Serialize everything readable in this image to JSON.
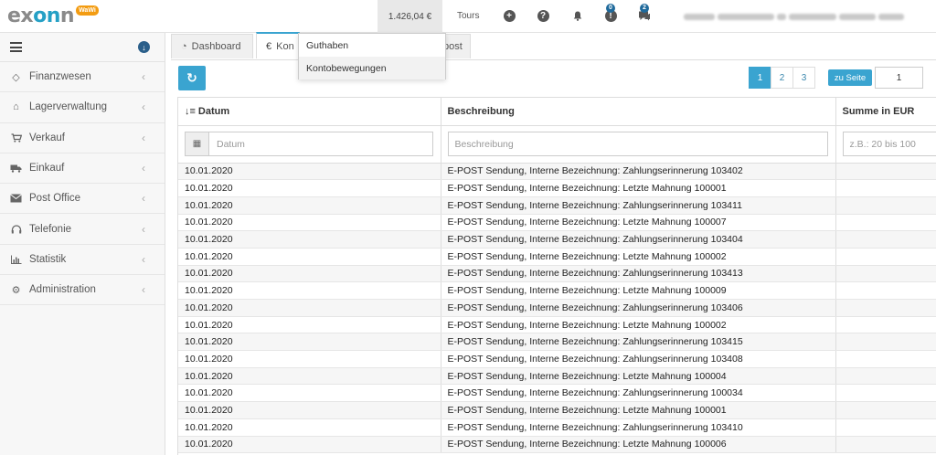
{
  "header": {
    "logo_main": "ex",
    "logo_o": "on",
    "logo_end": "n",
    "logo_badge": "WaWi",
    "balance": "1.426,04 €",
    "tours": "Tours",
    "notifications_count": "0",
    "messages_count": "2"
  },
  "sidebar": {
    "items": [
      {
        "label": "Finanzwesen",
        "icon": "tag-icon"
      },
      {
        "label": "Lagerverwaltung",
        "icon": "warehouse-icon"
      },
      {
        "label": "Verkauf",
        "icon": "cart-icon"
      },
      {
        "label": "Einkauf",
        "icon": "truck-icon"
      },
      {
        "label": "Post Office",
        "icon": "envelope-icon"
      },
      {
        "label": "Telefonie",
        "icon": "headset-icon"
      },
      {
        "label": "Statistik",
        "icon": "chart-icon"
      },
      {
        "label": "Administration",
        "icon": "cogs-icon"
      }
    ]
  },
  "tabs": {
    "dashboard": "Dashboard",
    "konto": "Kon",
    "hidden_tab": "post"
  },
  "dropdown": {
    "items": [
      "Guthaben",
      "Kontobewegungen"
    ]
  },
  "pager": {
    "pages": [
      "1",
      "2",
      "3"
    ],
    "goto_label": "zu Seite",
    "goto_value": "1"
  },
  "table": {
    "columns": [
      "Datum",
      "Beschreibung",
      "Summe in EUR"
    ],
    "filters": {
      "datum_placeholder": "Datum",
      "beschreibung_placeholder": "Beschreibung",
      "summe_placeholder": "z.B.: 20 bis 100"
    },
    "rows": [
      {
        "datum": "10.01.2020",
        "beschreibung": "E-POST Sendung, Interne Bezeichnung: Zahlungserinnerung 103402"
      },
      {
        "datum": "10.01.2020",
        "beschreibung": "E-POST Sendung, Interne Bezeichnung: Letzte Mahnung 100001"
      },
      {
        "datum": "10.01.2020",
        "beschreibung": "E-POST Sendung, Interne Bezeichnung: Zahlungserinnerung 103411"
      },
      {
        "datum": "10.01.2020",
        "beschreibung": "E-POST Sendung, Interne Bezeichnung: Letzte Mahnung 100007"
      },
      {
        "datum": "10.01.2020",
        "beschreibung": "E-POST Sendung, Interne Bezeichnung: Zahlungserinnerung 103404"
      },
      {
        "datum": "10.01.2020",
        "beschreibung": "E-POST Sendung, Interne Bezeichnung: Letzte Mahnung 100002"
      },
      {
        "datum": "10.01.2020",
        "beschreibung": "E-POST Sendung, Interne Bezeichnung: Zahlungserinnerung 103413"
      },
      {
        "datum": "10.01.2020",
        "beschreibung": "E-POST Sendung, Interne Bezeichnung: Letzte Mahnung 100009"
      },
      {
        "datum": "10.01.2020",
        "beschreibung": "E-POST Sendung, Interne Bezeichnung: Zahlungserinnerung 103406"
      },
      {
        "datum": "10.01.2020",
        "beschreibung": "E-POST Sendung, Interne Bezeichnung: Letzte Mahnung 100002"
      },
      {
        "datum": "10.01.2020",
        "beschreibung": "E-POST Sendung, Interne Bezeichnung: Zahlungserinnerung 103415"
      },
      {
        "datum": "10.01.2020",
        "beschreibung": "E-POST Sendung, Interne Bezeichnung: Zahlungserinnerung 103408"
      },
      {
        "datum": "10.01.2020",
        "beschreibung": "E-POST Sendung, Interne Bezeichnung: Letzte Mahnung 100004"
      },
      {
        "datum": "10.01.2020",
        "beschreibung": "E-POST Sendung, Interne Bezeichnung: Zahlungserinnerung 100034"
      },
      {
        "datum": "10.01.2020",
        "beschreibung": "E-POST Sendung, Interne Bezeichnung: Letzte Mahnung 100001"
      },
      {
        "datum": "10.01.2020",
        "beschreibung": "E-POST Sendung, Interne Bezeichnung: Zahlungserinnerung 103410"
      },
      {
        "datum": "10.01.2020",
        "beschreibung": "E-POST Sendung, Interne Bezeichnung: Letzte Mahnung 100006"
      }
    ]
  },
  "colors": {
    "accent": "#3aa4d0",
    "brand_dark": "#2b5f8a",
    "badge": "#1f6a9c",
    "logo_badge": "#f39c12"
  }
}
